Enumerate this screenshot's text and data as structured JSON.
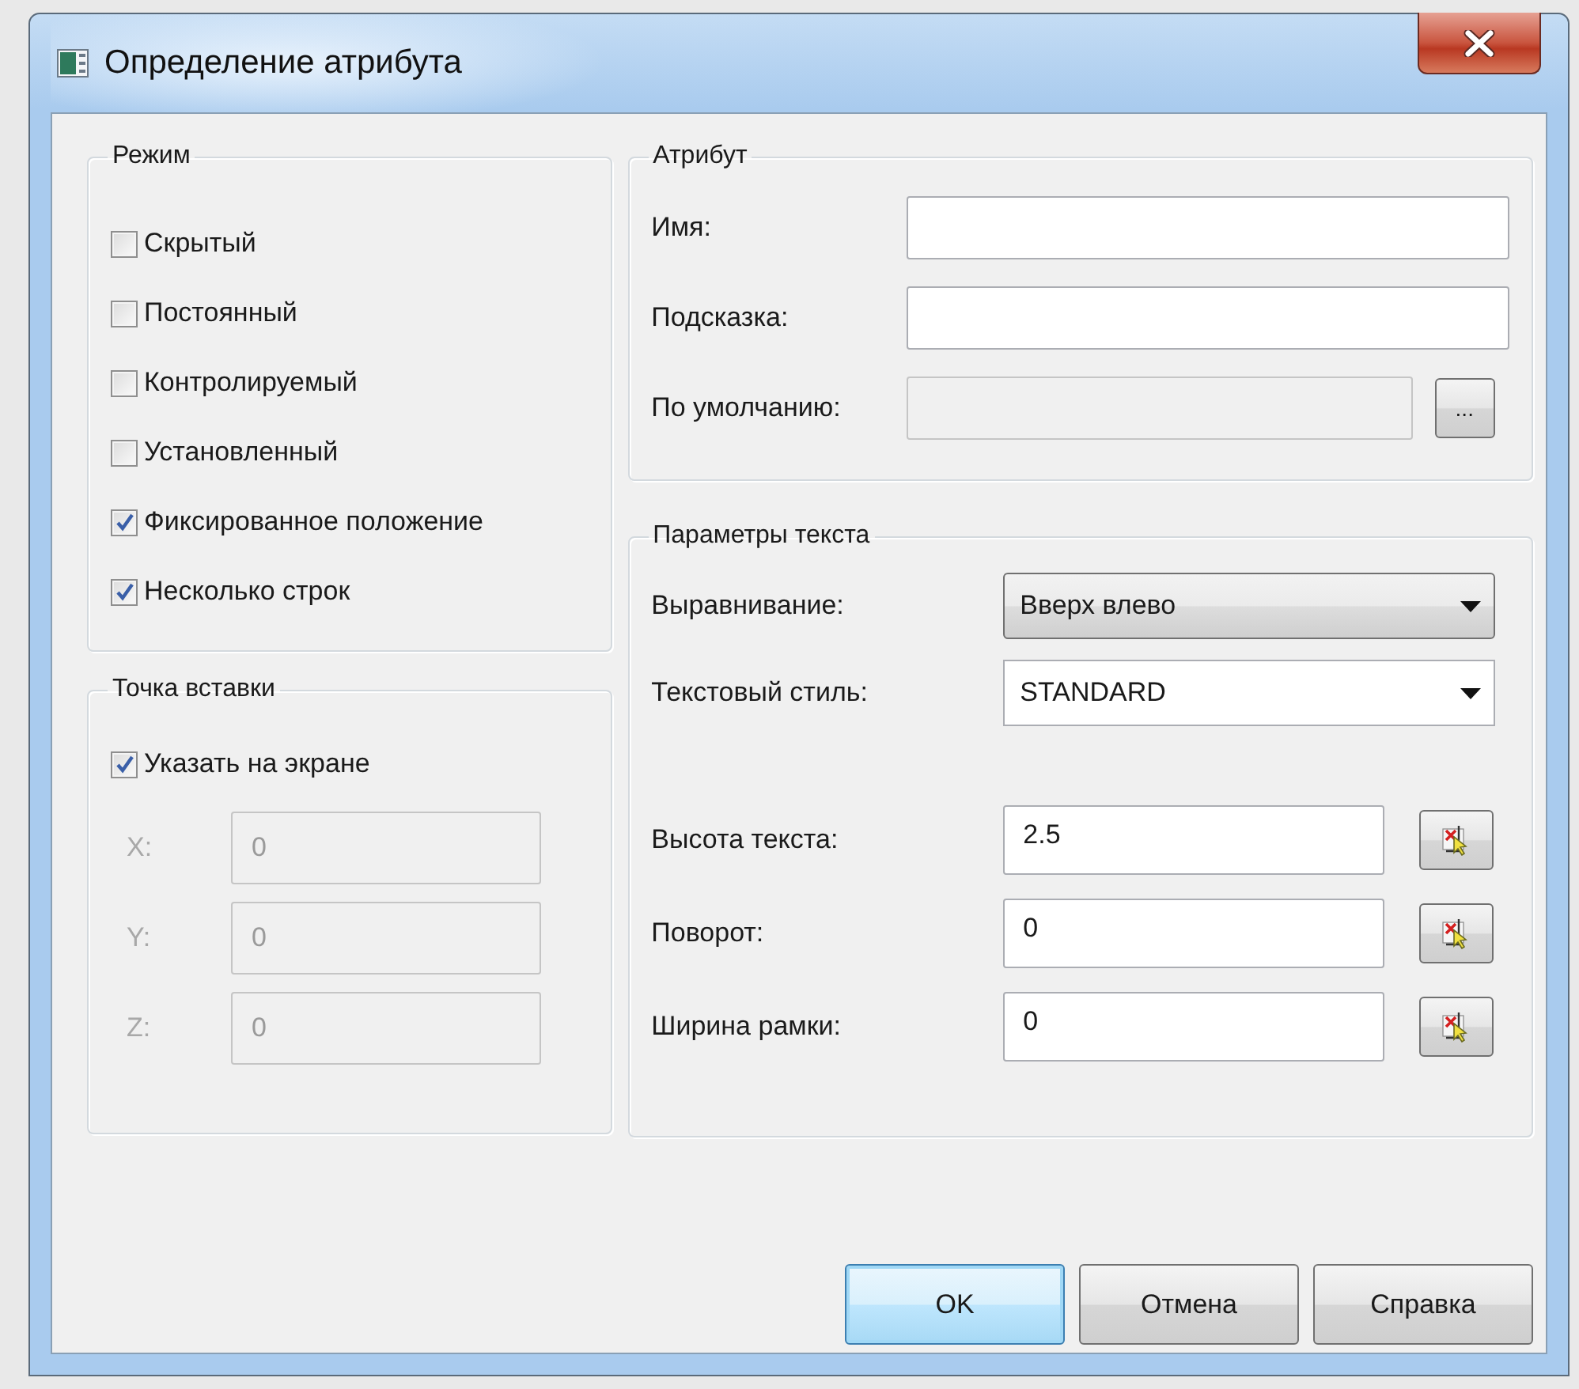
{
  "window": {
    "title": "Определение атрибута"
  },
  "mode": {
    "title": "Режим",
    "options": [
      {
        "label": "Скрытый",
        "checked": false
      },
      {
        "label": "Постоянный",
        "checked": false
      },
      {
        "label": "Контролируемый",
        "checked": false
      },
      {
        "label": "Установленный",
        "checked": false
      },
      {
        "label": "Фиксированное положение",
        "checked": true
      },
      {
        "label": "Несколько строк",
        "checked": true
      }
    ]
  },
  "insertion_point": {
    "title": "Точка вставки",
    "specify_on_screen": {
      "label": "Указать на экране",
      "checked": true
    },
    "coordinates": [
      {
        "label": "X:",
        "value": "0",
        "disabled": true
      },
      {
        "label": "Y:",
        "value": "0",
        "disabled": true
      },
      {
        "label": "Z:",
        "value": "0",
        "disabled": true
      }
    ]
  },
  "attribute": {
    "title": "Атрибут",
    "fields": [
      {
        "label": "Имя:",
        "disabled": false
      },
      {
        "label": "Подсказка:",
        "disabled": false
      },
      {
        "label": "По умолчанию:",
        "disabled": true,
        "button": "..."
      }
    ]
  },
  "text_settings": {
    "title": "Параметры текста",
    "dropdowns": [
      {
        "label": "Выравнивание:",
        "value": "Вверх влево",
        "kind": "list"
      },
      {
        "label": "Текстовый стиль:",
        "value": "STANDARD",
        "kind": "editable"
      }
    ],
    "fields": [
      {
        "label": "Высота текста:",
        "value": "2.5"
      },
      {
        "label": "Поворот:",
        "value": "0"
      },
      {
        "label": "Ширина рамки:",
        "value": "0"
      }
    ]
  },
  "buttons": [
    {
      "label": "OK",
      "default": true
    },
    {
      "label": "Отмена",
      "default": false
    },
    {
      "label": "Справка",
      "default": false
    }
  ]
}
